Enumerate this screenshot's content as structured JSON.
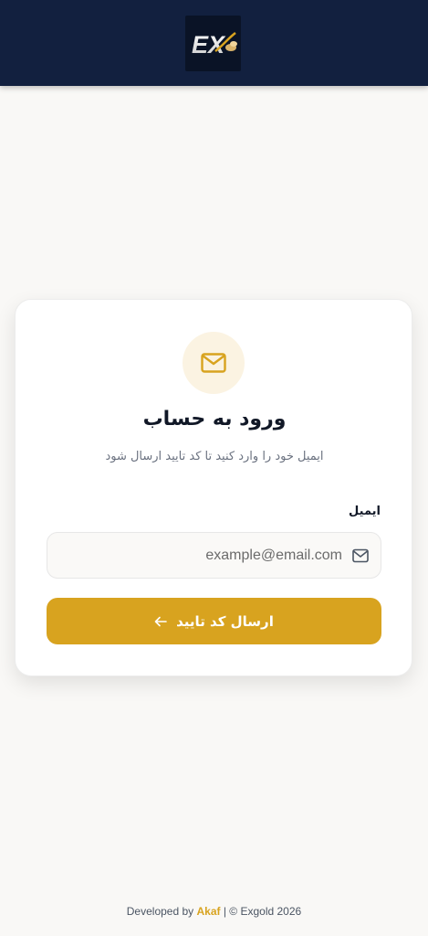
{
  "header": {
    "logo_text": "EX",
    "background_color": "#12203f"
  },
  "card": {
    "icon": "mail-icon",
    "title": "ورود به حساب",
    "subtitle": "ایمیل خود را وارد کنید تا کد تایید ارسال شود",
    "email_label": "ایمیل",
    "email_placeholder": "example@email.com",
    "email_value": "",
    "email_icon": "mail-icon",
    "submit_label": "ارسال کد تایید",
    "submit_icon": "arrow-left-icon"
  },
  "footer": {
    "prefix": "Developed by",
    "brand": "Akaf",
    "suffix": "| © Exgold 2026"
  },
  "colors": {
    "accent": "#d8a31f",
    "header": "#12203f",
    "background": "#f9f8f6",
    "icon_bg": "#fbf3e2"
  }
}
